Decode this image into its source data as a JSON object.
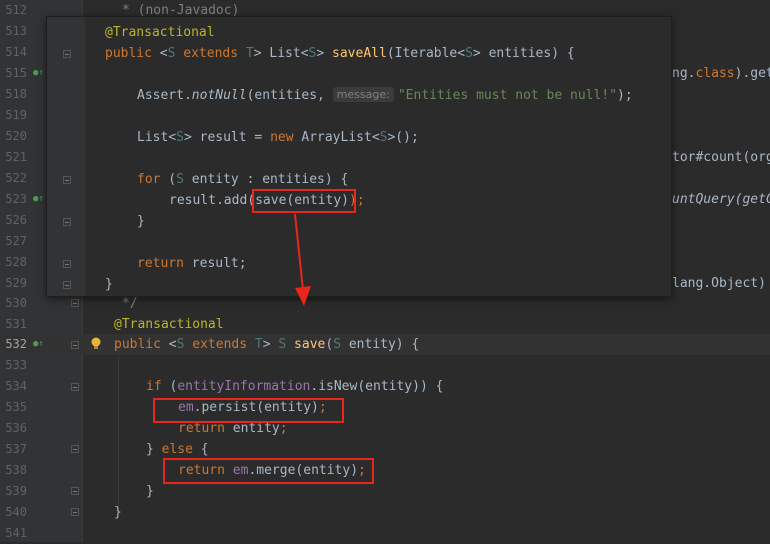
{
  "background_lines": [
    {
      "num": "512"
    },
    {
      "num": "513"
    },
    {
      "num": "514"
    },
    {
      "num": "515"
    },
    {
      "num": "518"
    },
    {
      "num": "519"
    },
    {
      "num": "520"
    },
    {
      "num": "521"
    },
    {
      "num": "522"
    },
    {
      "num": "523"
    },
    {
      "num": "526"
    },
    {
      "num": "527"
    },
    {
      "num": "528"
    },
    {
      "num": "529"
    },
    {
      "num": "530"
    },
    {
      "num": "531"
    },
    {
      "num": "532"
    },
    {
      "num": "533"
    },
    {
      "num": "534"
    },
    {
      "num": "535"
    },
    {
      "num": "536"
    },
    {
      "num": "537"
    },
    {
      "num": "538"
    },
    {
      "num": "539"
    },
    {
      "num": "540"
    },
    {
      "num": "541"
    }
  ],
  "background_code": {
    "l512": "* (non-Javadoc)",
    "l530": "*/",
    "l531": "@Transactional",
    "l532_public": "public",
    "l532_lt": " <",
    "l532_S": "S",
    "l532_extends": " extends ",
    "l532_T": "T",
    "l532_gt": "> ",
    "l532_S2": "S",
    "l532_save": " save",
    "l532_paren": "(",
    "l532_S3": "S",
    "l532_rest": " entity) {",
    "l534_if": "if",
    "l534_a": " (",
    "l534_field": "entityInformation",
    "l534_b": ".isNew(entity)) {",
    "l535_em": "em",
    "l535_rest": ".persist(entity)",
    "l535_semi": ";",
    "l536_return": "return",
    "l536_rest": " entity",
    "l536_semi": ";",
    "l537_a": "} ",
    "l537_else": "else",
    "l537_b": " {",
    "l538_return": "return",
    "l538_em": " em",
    "l538_rest": ".merge(entity)",
    "l538_semi": ";",
    "l539": "}",
    "l540": "}"
  },
  "ghost_text": {
    "g515_a": "ng.",
    "g515_class": "class",
    "g515_b": ").get",
    "g521": "tor#count(org",
    "g523": "untQuery(getC",
    "g529": "lang.Object)"
  },
  "popup": {
    "l1_ann": "@Transactional",
    "l2_public": "public",
    "l2_a": " <",
    "l2_S": "S",
    "l2_extends": " extends ",
    "l2_T": "T",
    "l2_b": "> List<",
    "l2_S2": "S",
    "l2_c": "> ",
    "l2_fn": "saveAll",
    "l2_d": "(Iterable<",
    "l2_S3": "S",
    "l2_e": "> entities) {",
    "l3_a": "Assert.",
    "l3_fn": "notNull",
    "l3_b": "(entities, ",
    "l3_hint": "message:",
    "l3_str": "\"Entities must not be null!\"",
    "l3_c": ");",
    "l4_a": "List<",
    "l4_S": "S",
    "l4_b": "> result = ",
    "l4_new": "new",
    "l4_c": " ArrayList<",
    "l4_S2": "S",
    "l4_d": ">();",
    "l5_for": "for",
    "l5_a": " (",
    "l5_S": "S",
    "l5_b": " entity : entities) {",
    "l6_a": "result.add(",
    "l6_b": "save(entity)",
    "l6_c": ");",
    "l7": "}",
    "l8_return": "return",
    "l8_rest": " result;",
    "l9": "}"
  },
  "colors": {
    "background": "#2b2b2b",
    "keyword": "#cc7832",
    "annotation": "#bbb529",
    "type_param": "#507874",
    "method": "#ffc66d",
    "string": "#6a8759",
    "field": "#9876aa",
    "highlight_box": "#e8261c"
  },
  "icons": [
    "override-gutter-icon",
    "intention-bulb-icon",
    "fold-marker-icon",
    "arrow-down-icon"
  ]
}
